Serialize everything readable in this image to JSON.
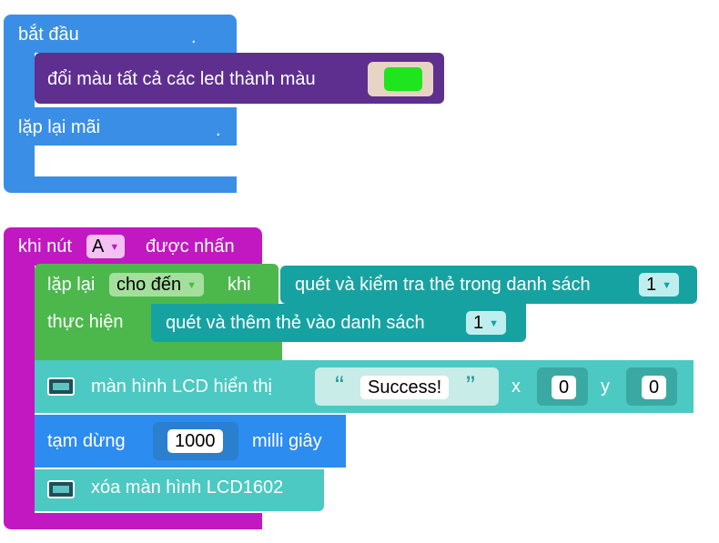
{
  "colors": {
    "event_blue": "#3a8ee6",
    "led_purple": "#5e2f8f",
    "green_led": "#1ee51e",
    "button_event": "#c218c2",
    "loop_green": "#4cb84c",
    "rfid_teal": "#17a2a2",
    "lcd_teal": "#4cc9c2",
    "timing_blue": "#2c8cf0"
  },
  "block_start": {
    "label": "bắt đầu",
    "dot": ".",
    "led_label": "đổi màu tất cả các led thành màu"
  },
  "block_forever": {
    "label": "lặp lại mãi",
    "dot": "."
  },
  "button_event": {
    "prefix": "khi nút",
    "button_value": "A",
    "suffix": "được nhấn"
  },
  "repeat_until": {
    "label": "lặp lại",
    "mode_value": "cho đến",
    "when_label": "khi",
    "condition_label": "quét và kiểm tra thẻ trong danh sách",
    "condition_list_value": "1",
    "do_label": "thực hiện",
    "action_label": "quét và thêm thẻ vào danh sách",
    "action_list_value": "1"
  },
  "lcd_show": {
    "label": "màn hình LCD hiển thị",
    "open_quote": "“",
    "text_value": "Success!",
    "close_quote": "”",
    "x_label": "x",
    "x_value": "0",
    "y_label": "y",
    "y_value": "0"
  },
  "pause": {
    "label": "tạm dừng",
    "value": "1000",
    "unit_label": "milli giây"
  },
  "lcd_clear": {
    "label": "xóa màn hình LCD1602"
  }
}
